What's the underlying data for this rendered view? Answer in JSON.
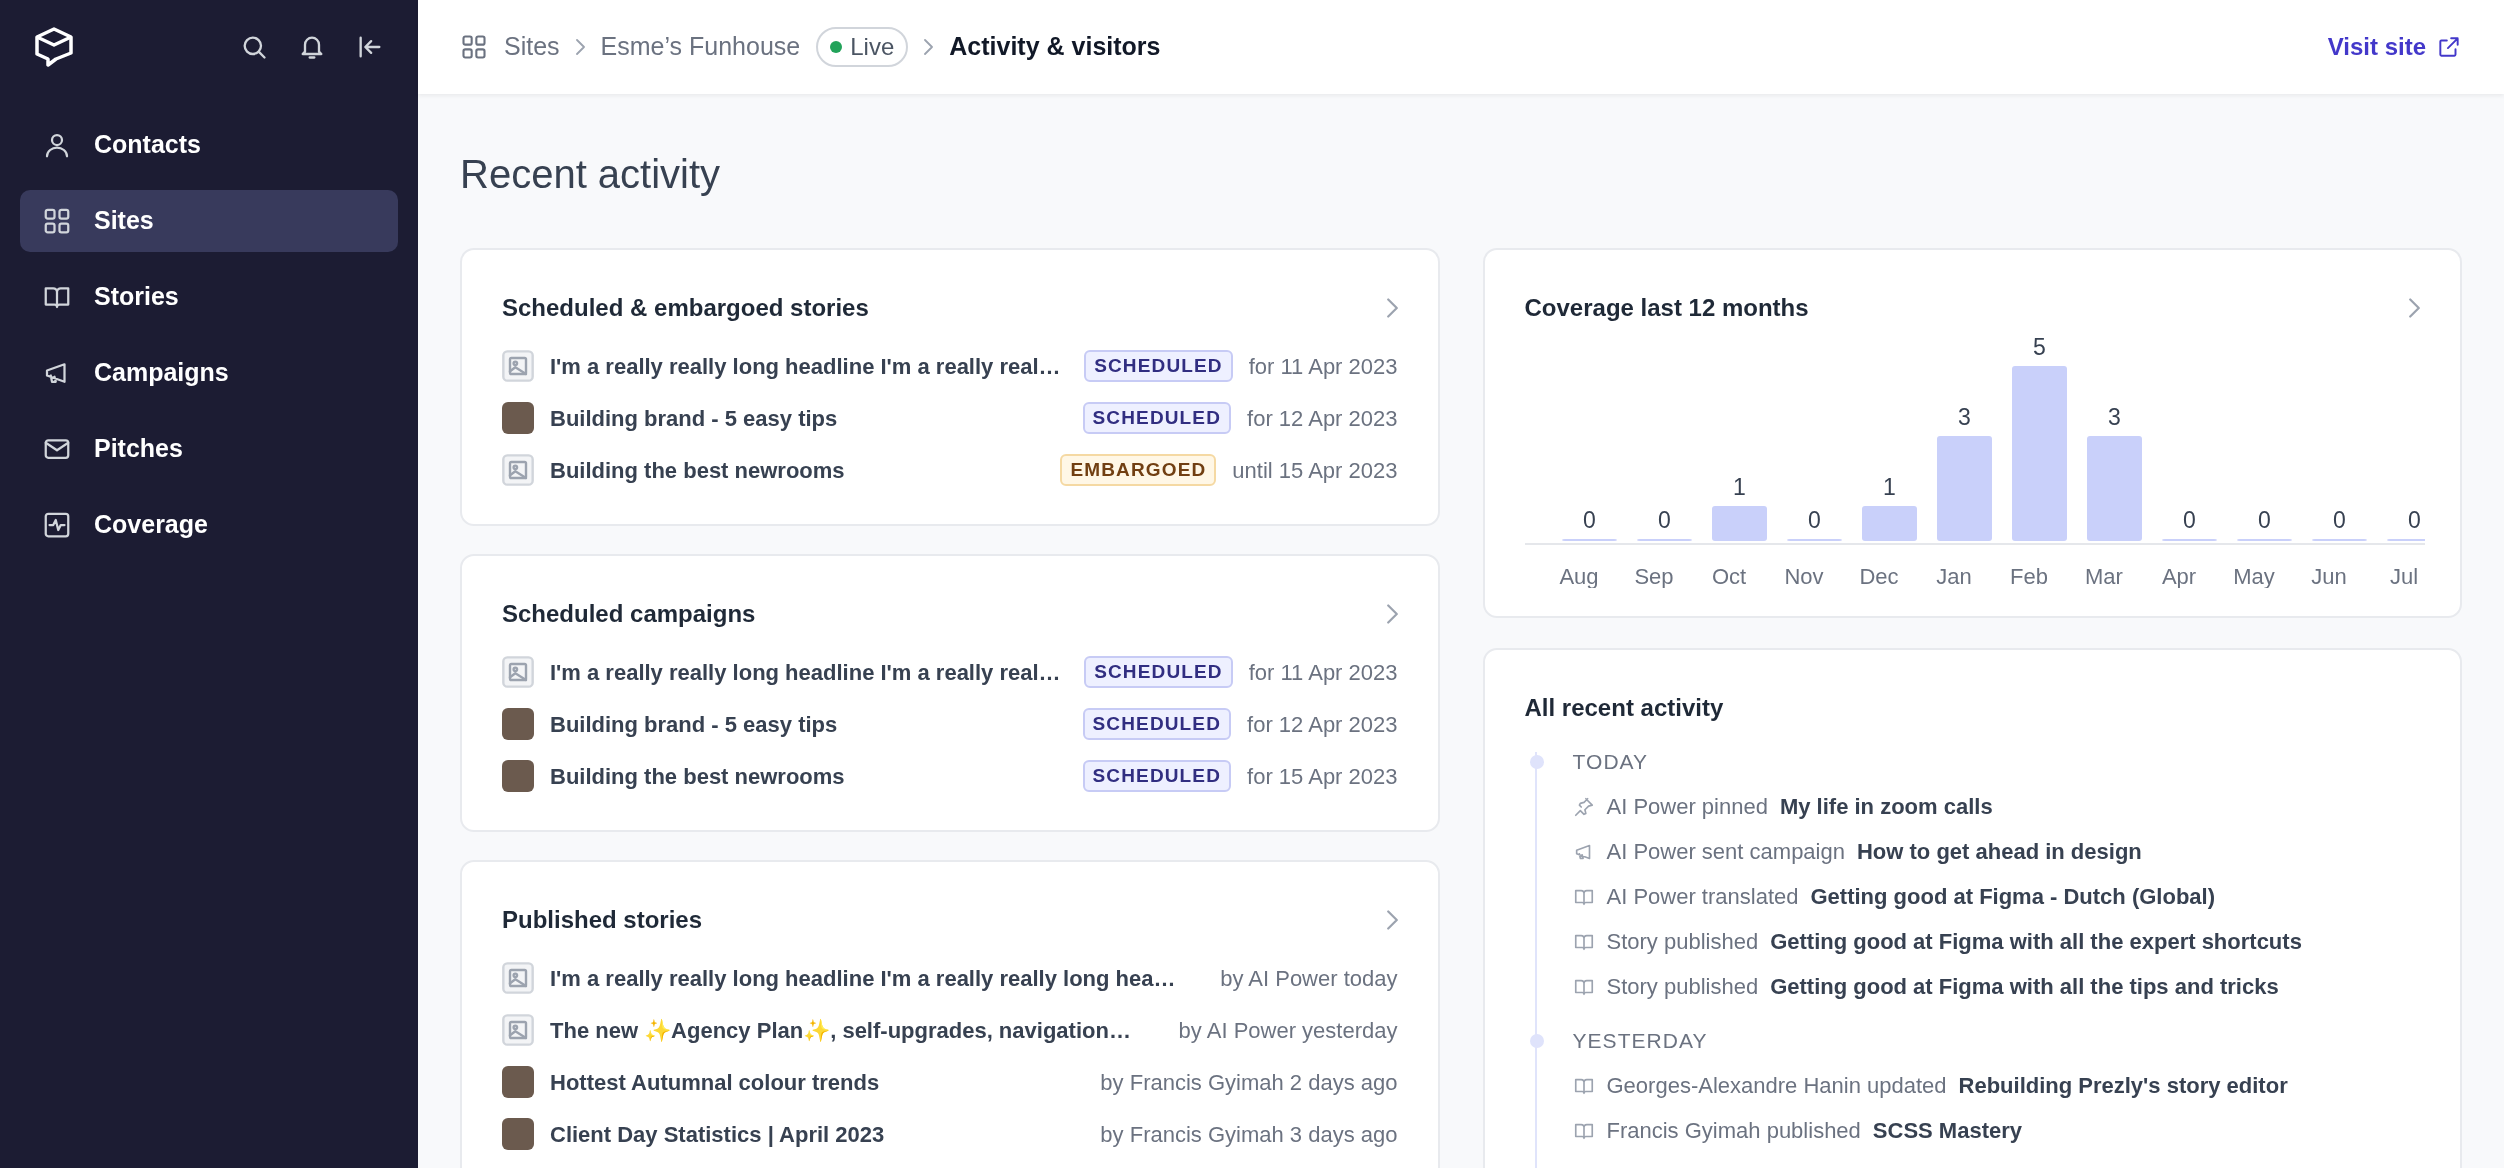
{
  "sidebar": {
    "items": [
      {
        "label": "Contacts",
        "selected": false
      },
      {
        "label": "Sites",
        "selected": true
      },
      {
        "label": "Stories",
        "selected": false
      },
      {
        "label": "Campaigns",
        "selected": false
      },
      {
        "label": "Pitches",
        "selected": false
      },
      {
        "label": "Coverage",
        "selected": false
      }
    ]
  },
  "breadcrumb": {
    "items": [
      "Sites",
      "Esme’s Funhouse"
    ],
    "status": "Live",
    "current": "Activity & visitors"
  },
  "visit_link": "Visit site",
  "page_title": "Recent activity",
  "scheduled_stories": {
    "title": "Scheduled & embargoed stories",
    "rows": [
      {
        "kind": "image",
        "title": "I'm a really really long headline I'm a really real…",
        "badge": {
          "kind": "scheduled",
          "text": "SCHEDULED"
        },
        "when": "for 11 Apr 2023"
      },
      {
        "kind": "photo",
        "title": "Building brand - 5 easy tips",
        "badge": {
          "kind": "scheduled",
          "text": "SCHEDULED"
        },
        "when": "for 12 Apr 2023"
      },
      {
        "kind": "image",
        "title": "Building the best newrooms",
        "badge": {
          "kind": "embargoed",
          "text": "EMBARGOED"
        },
        "when": "until 15 Apr 2023"
      }
    ]
  },
  "scheduled_campaigns": {
    "title": "Scheduled campaigns",
    "rows": [
      {
        "kind": "image",
        "title": "I'm a really really long headline I'm a really real…",
        "badge": {
          "kind": "scheduled",
          "text": "SCHEDULED"
        },
        "when": "for 11 Apr 2023"
      },
      {
        "kind": "photo",
        "title": "Building brand - 5 easy tips",
        "badge": {
          "kind": "scheduled",
          "text": "SCHEDULED"
        },
        "when": "for 12 Apr 2023"
      },
      {
        "kind": "photo",
        "title": "Building the best newrooms",
        "badge": {
          "kind": "scheduled",
          "text": "SCHEDULED"
        },
        "when": "for 15 Apr 2023"
      }
    ]
  },
  "published_stories": {
    "title": "Published stories",
    "rows": [
      {
        "kind": "image",
        "title": "I'm a really really long headline I'm a really really long hea…",
        "when": "by AI Power today"
      },
      {
        "kind": "image",
        "title": "The new ✨Agency Plan✨, self-upgrades, navigation…",
        "when": "by AI Power yesterday"
      },
      {
        "kind": "photo",
        "title": "Hottest Autumnal colour trends",
        "when": "by Francis Gyimah 2 days ago"
      },
      {
        "kind": "photo",
        "title": "Client Day Statistics | April 2023",
        "when": "by Francis Gyimah 3 days ago"
      }
    ]
  },
  "coverage": {
    "title": "Coverage last 12 months",
    "chart_data": {
      "type": "bar",
      "categories": [
        "Aug",
        "Sep",
        "Oct",
        "Nov",
        "Dec",
        "Jan",
        "Feb",
        "Mar",
        "Apr",
        "May",
        "Jun",
        "Jul"
      ],
      "values": [
        0,
        0,
        1,
        0,
        1,
        3,
        5,
        3,
        0,
        0,
        0,
        0
      ],
      "data_labels": true
    }
  },
  "activity": {
    "title": "All recent activity",
    "groups": [
      {
        "label": "TODAY",
        "items": [
          {
            "kind": "pin",
            "text": "AI Power pinned",
            "subject": "My life in zoom calls"
          },
          {
            "kind": "campaign",
            "text": "AI Power sent campaign",
            "subject": "How to get ahead in design"
          },
          {
            "kind": "story",
            "text": "AI Power translated",
            "subject": "Getting good at Figma - Dutch (Global)"
          },
          {
            "kind": "story",
            "text": "Story published",
            "subject": "Getting good at Figma with all the expert shortcuts"
          },
          {
            "kind": "story",
            "text": "Story published",
            "subject": "Getting good at Figma with all the tips and tricks"
          }
        ]
      },
      {
        "label": "YESTERDAY",
        "items": [
          {
            "kind": "story",
            "text": "Georges-Alexandre Hanin updated",
            "subject": "Rebuilding Prezly's story editor"
          },
          {
            "kind": "story",
            "text": "Francis Gyimah published",
            "subject": "SCSS Mastery"
          }
        ]
      }
    ]
  }
}
